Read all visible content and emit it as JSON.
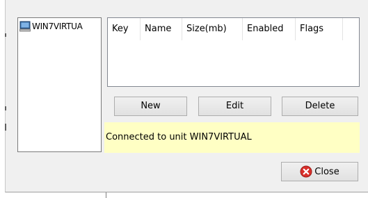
{
  "tree": {
    "items": [
      {
        "label": "WIN7VIRTUA",
        "icon": "computer-icon"
      }
    ]
  },
  "table": {
    "columns": [
      "Key",
      "Name",
      "Size(mb)",
      "Enabled",
      "Flags"
    ],
    "rows": []
  },
  "buttons": {
    "new_label": "New",
    "edit_label": "Edit",
    "delete_label": "Delete",
    "close_label": "Close"
  },
  "status": {
    "text": "Connected to unit WIN7VIRTUAL"
  },
  "colors": {
    "dialog_bg": "#f0f0f0",
    "status_bg": "#ffffc4",
    "close_icon_red": "#d9302b"
  }
}
